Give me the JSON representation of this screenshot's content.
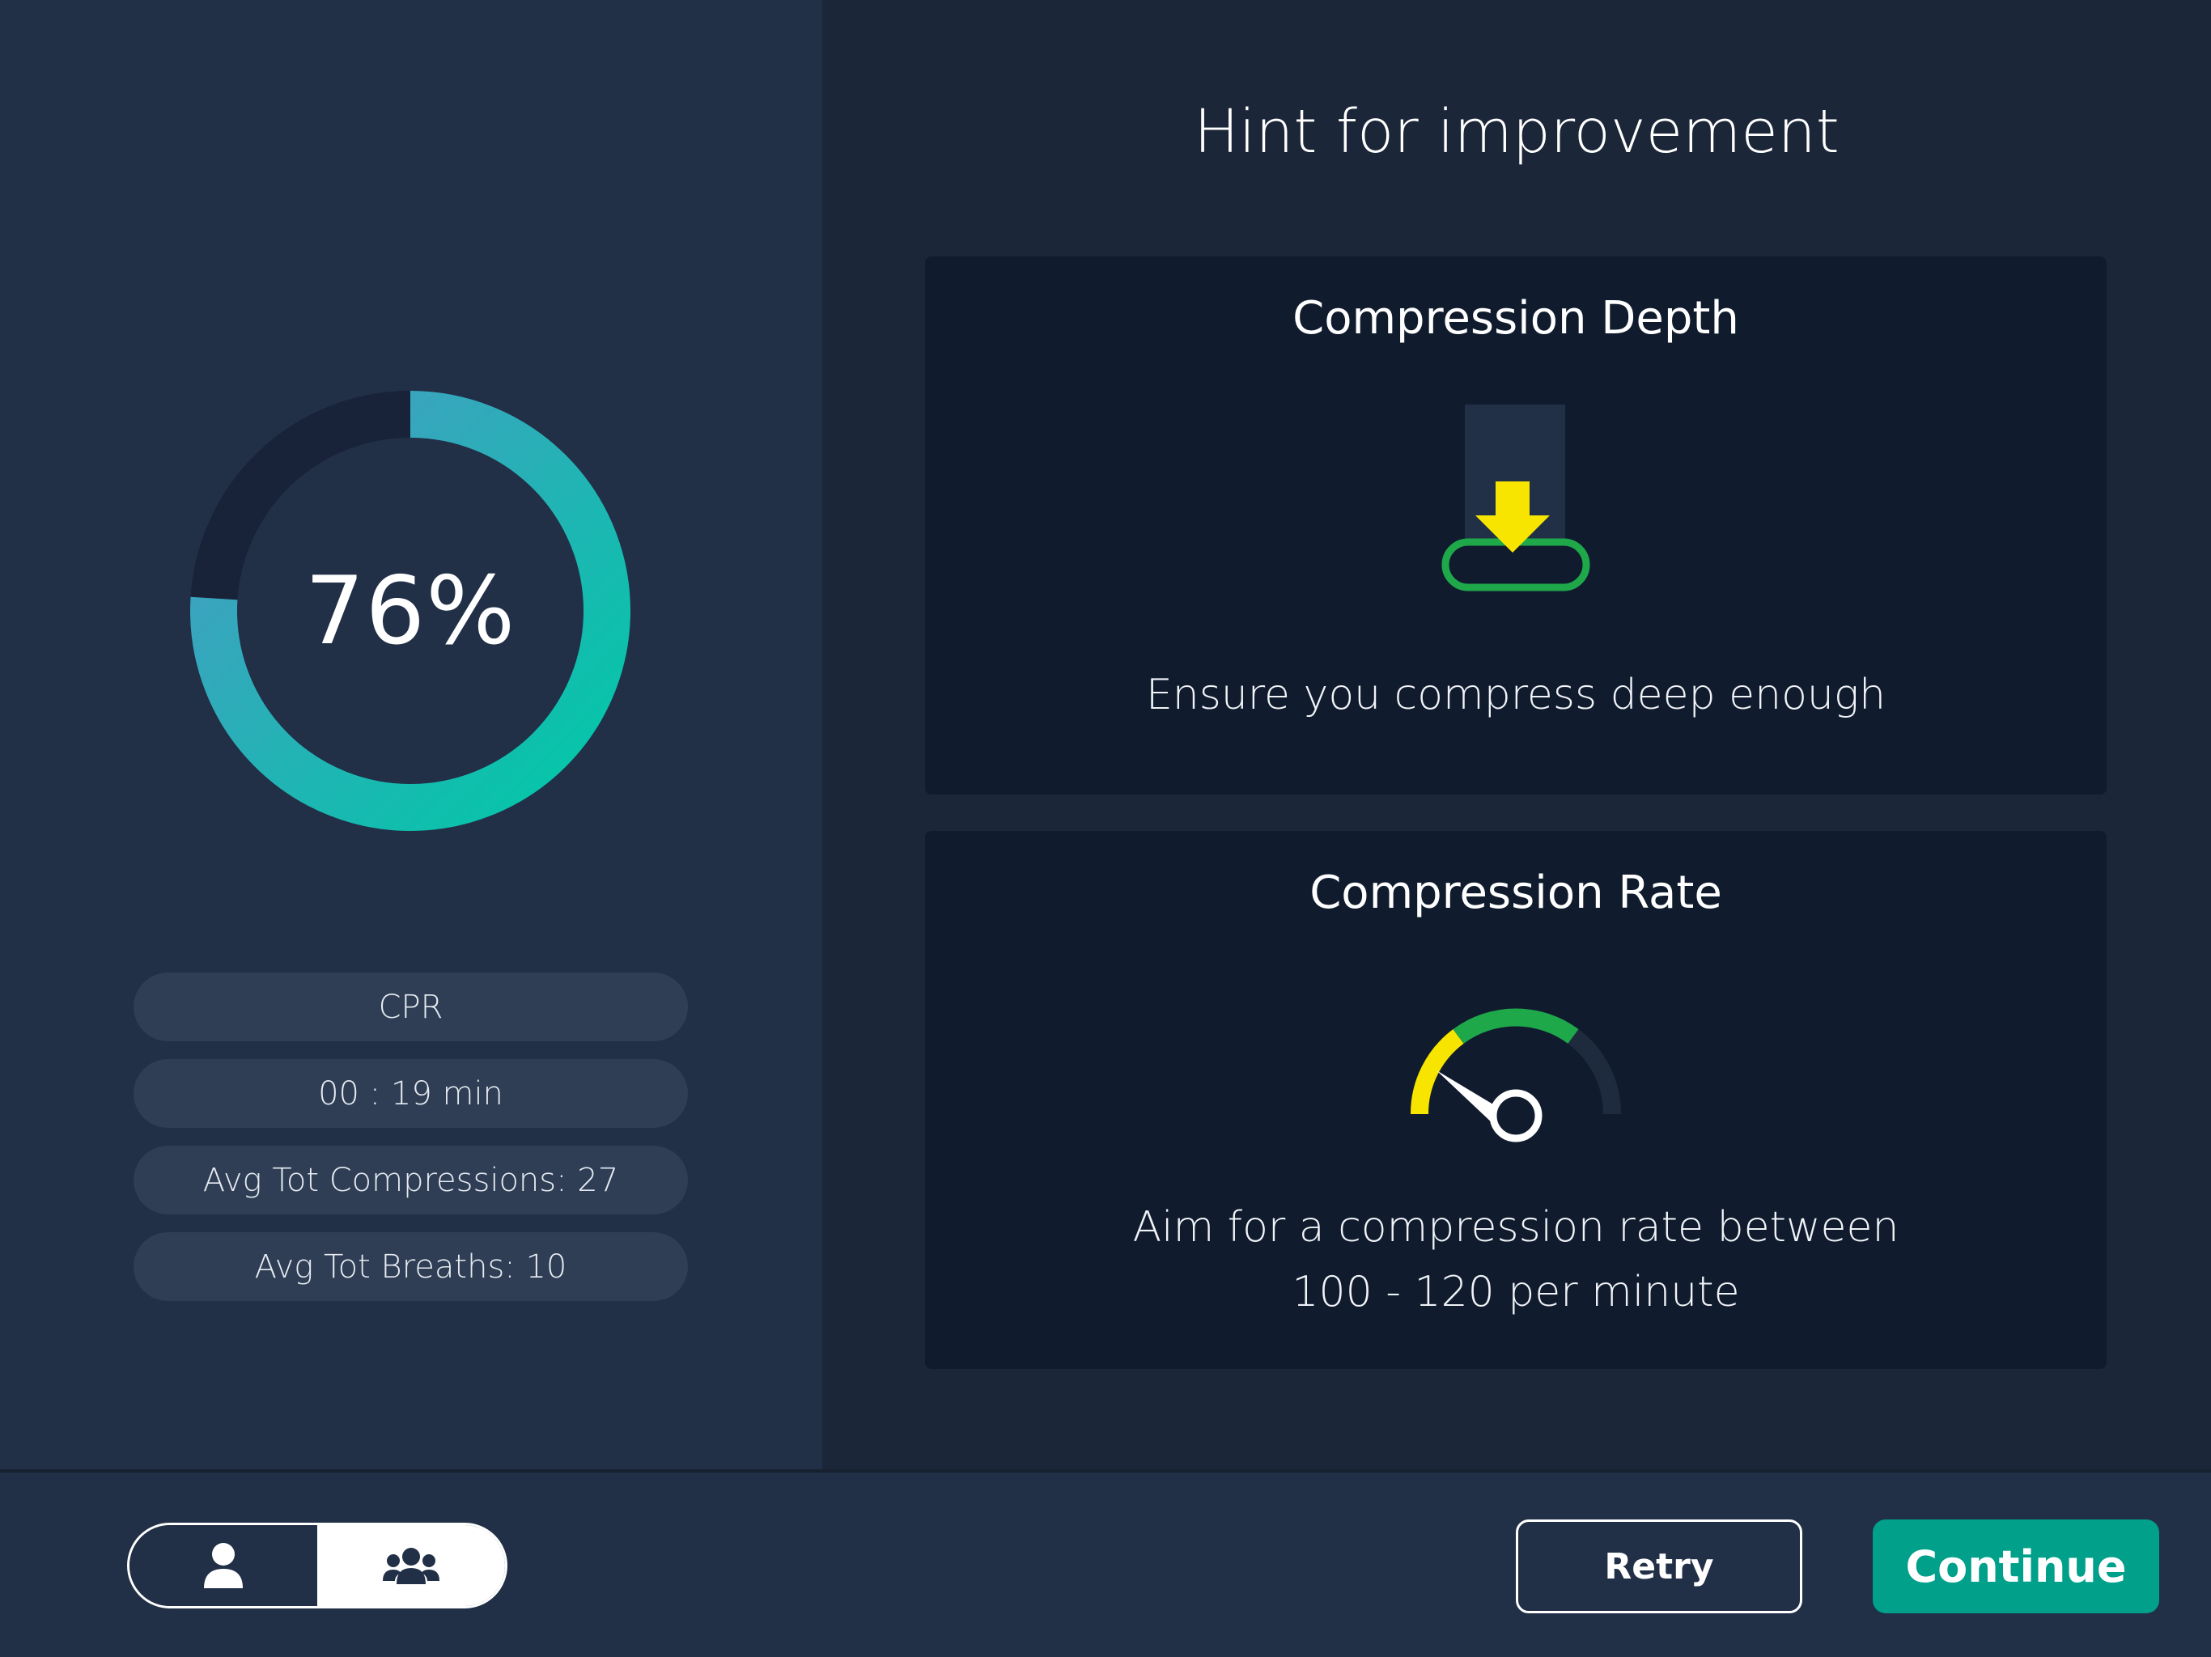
{
  "summary": {
    "score": "76%",
    "score_value": 0.76,
    "stats": [
      "CPR",
      "00 : 19 min",
      "Avg Tot Compressions: 27",
      "Avg Tot Breaths: 10"
    ]
  },
  "hints": {
    "title": "Hint for improvement",
    "depth": {
      "title": "Compression Depth",
      "text": "Ensure you compress deep enough"
    },
    "rate": {
      "title": "Compression Rate",
      "text_line1": "Aim for a compression rate between",
      "text_line2": "100 - 120 per minute"
    }
  },
  "footer": {
    "retry_label": "Retry",
    "continue_label": "Continue"
  },
  "colors": {
    "accent": "#00a08a",
    "ring_start": "#00c9a7",
    "ring_end": "#4a9ac4",
    "warning": "#f7e500",
    "good": "#1fa84a"
  },
  "icons": {
    "single_user": "person-icon",
    "group": "group-icon",
    "depth": "compression-depth-icon",
    "rate": "rate-gauge-icon"
  }
}
